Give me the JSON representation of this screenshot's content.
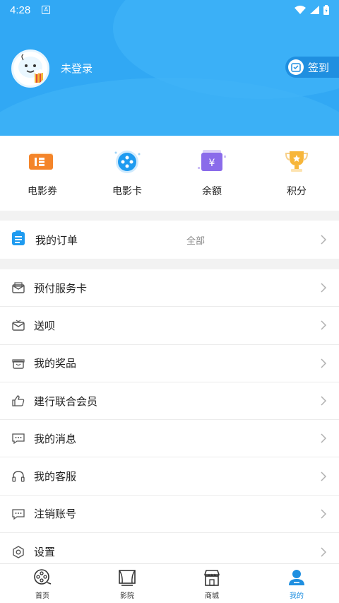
{
  "status_bar": {
    "time": "4:28",
    "notification_icon_letter": "A"
  },
  "header": {
    "login_status": "未登录",
    "checkin_label": "签到"
  },
  "assets": [
    {
      "label": "电影券",
      "icon": "ticket-icon"
    },
    {
      "label": "电影卡",
      "icon": "film-card-icon"
    },
    {
      "label": "余额",
      "icon": "wallet-icon"
    },
    {
      "label": "积分",
      "icon": "trophy-icon"
    }
  ],
  "orders": {
    "title": "我的订单",
    "all_label": "全部"
  },
  "menu": [
    {
      "label": "预付服务卡",
      "icon": "prepaid-card-icon"
    },
    {
      "label": "送呗",
      "icon": "gift-mail-icon"
    },
    {
      "label": "我的奖品",
      "icon": "prize-icon"
    },
    {
      "label": "建行联合会员",
      "icon": "thumb-up-icon"
    },
    {
      "label": "我的消息",
      "icon": "message-icon"
    },
    {
      "label": "我的客服",
      "icon": "headset-icon"
    },
    {
      "label": "注销账号",
      "icon": "cancel-account-icon"
    },
    {
      "label": "设置",
      "icon": "settings-icon"
    }
  ],
  "bottom_nav": [
    {
      "label": "首页",
      "icon": "film-reel-icon"
    },
    {
      "label": "影院",
      "icon": "theater-icon"
    },
    {
      "label": "商城",
      "icon": "shop-icon"
    },
    {
      "label": "我的",
      "icon": "user-icon",
      "active": true
    }
  ],
  "colors": {
    "brand_blue": "#31a8f4",
    "active_blue": "#1f8fe0"
  }
}
